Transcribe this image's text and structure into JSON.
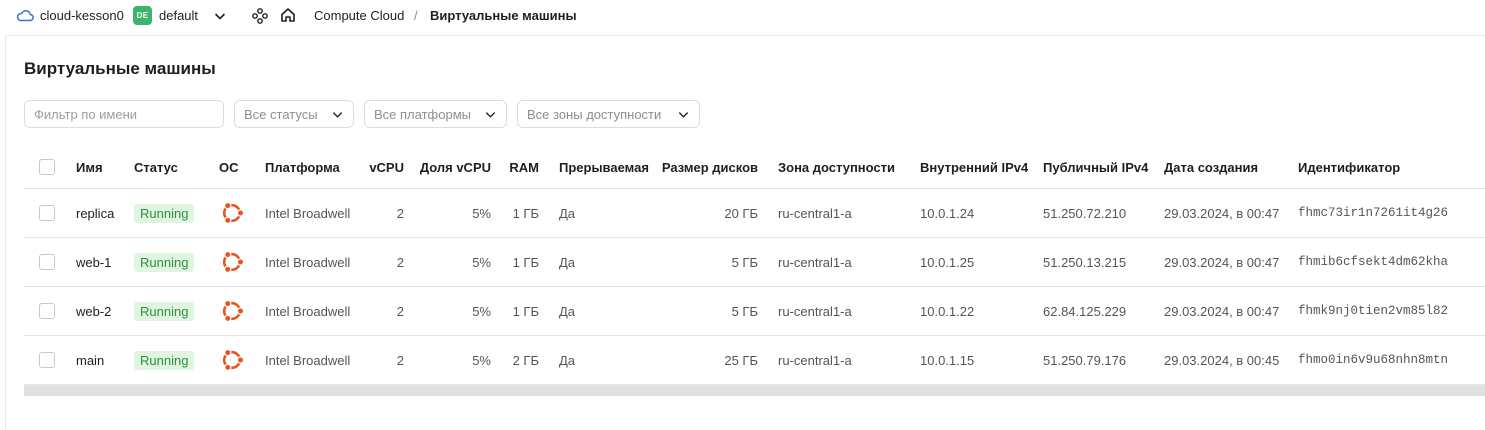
{
  "topbar": {
    "cloud_icon": "cloud-icon",
    "cloud_name": "cloud-kesson0",
    "folder_badge": "DE",
    "folder_name": "default",
    "services_icon": "services-grid-icon",
    "home_icon": "home-icon",
    "breadcrumb_service": "Compute Cloud",
    "breadcrumb_separator": "/",
    "breadcrumb_current": "Виртуальные машины"
  },
  "page": {
    "title": "Виртуальные машины"
  },
  "filters": {
    "name_placeholder": "Фильтр по имени",
    "status": "Все статусы",
    "platform": "Все платформы",
    "zone": "Все зоны доступности"
  },
  "table": {
    "columns": {
      "name": "Имя",
      "status": "Статус",
      "os": "ОС",
      "platform": "Платформа",
      "vcpu": "vCPU",
      "vcpu_share": "Доля vCPU",
      "ram": "RAM",
      "preemptible": "Прерываемая",
      "disk_size": "Размер дисков",
      "zone": "Зона доступности",
      "internal_ip": "Внутренний IPv4",
      "public_ip": "Публичный IPv4",
      "created": "Дата создания",
      "id": "Идентификатор"
    },
    "rows": [
      {
        "name": "replica",
        "status": "Running",
        "os_icon": "ubuntu-icon",
        "platform": "Intel Broadwell",
        "vcpu": "2",
        "vcpu_share": "5%",
        "ram": "1 ГБ",
        "preemptible": "Да",
        "disk_size": "20 ГБ",
        "zone": "ru-central1-a",
        "internal_ip": "10.0.1.24",
        "public_ip": "51.250.72.210",
        "created": "29.03.2024, в 00:47",
        "id": "fhmc73ir1n7261it4g26"
      },
      {
        "name": "web-1",
        "status": "Running",
        "os_icon": "ubuntu-icon",
        "platform": "Intel Broadwell",
        "vcpu": "2",
        "vcpu_share": "5%",
        "ram": "1 ГБ",
        "preemptible": "Да",
        "disk_size": "5 ГБ",
        "zone": "ru-central1-a",
        "internal_ip": "10.0.1.25",
        "public_ip": "51.250.13.215",
        "created": "29.03.2024, в 00:47",
        "id": "fhmib6cfsekt4dm62kha"
      },
      {
        "name": "web-2",
        "status": "Running",
        "os_icon": "ubuntu-icon",
        "platform": "Intel Broadwell",
        "vcpu": "2",
        "vcpu_share": "5%",
        "ram": "1 ГБ",
        "preemptible": "Да",
        "disk_size": "5 ГБ",
        "zone": "ru-central1-a",
        "internal_ip": "10.0.1.22",
        "public_ip": "62.84.125.229",
        "created": "29.03.2024, в 00:47",
        "id": "fhmk9nj0tien2vm85l82"
      },
      {
        "name": "main",
        "status": "Running",
        "os_icon": "ubuntu-icon",
        "platform": "Intel Broadwell",
        "vcpu": "2",
        "vcpu_share": "5%",
        "ram": "2 ГБ",
        "preemptible": "Да",
        "disk_size": "25 ГБ",
        "zone": "ru-central1-a",
        "internal_ip": "10.0.1.15",
        "public_ip": "51.250.79.176",
        "created": "29.03.2024, в 00:45",
        "id": "fhmo0in6v9u68nhn8mtn"
      }
    ]
  },
  "colors": {
    "folder_badge": "#3fb56b",
    "status_running_bg": "#dff5e0",
    "status_running_text": "#2f8f43",
    "ubuntu_orange": "#e95420",
    "cloud_icon": "#3a6fd8"
  }
}
